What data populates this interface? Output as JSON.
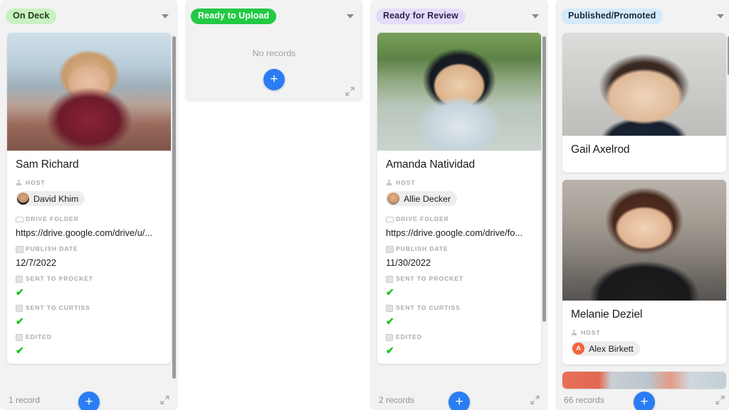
{
  "columns": [
    {
      "id": "on-deck",
      "tag": "On Deck",
      "tag_bg": "#c8f0c0",
      "tag_color": "#1e3a1a",
      "record_count": "1 record",
      "empty_text": null,
      "scrollbar": {
        "top_pct": 1,
        "height_pct": 96
      },
      "cards": [
        {
          "title": "Sam Richard",
          "photo": "ph-sam",
          "fields": [
            {
              "label": "HOST",
              "icon": "person-icon",
              "type": "chip",
              "value": "David Khim",
              "avatar_class": "ph-david",
              "avatar_letter": ""
            },
            {
              "label": "DRIVE FOLDER",
              "icon": "link-icon",
              "type": "text",
              "value": "https://drive.google.com/drive/u/..."
            },
            {
              "label": "PUBLISH DATE",
              "icon": "calendar-icon",
              "type": "text",
              "value": "12/7/2022"
            },
            {
              "label": "SENT TO PROCKET",
              "icon": "checkbox-icon",
              "type": "check",
              "value": "✔"
            },
            {
              "label": "SENT TO CURTISS",
              "icon": "checkbox-icon",
              "type": "check",
              "value": "✔"
            },
            {
              "label": "EDITED",
              "icon": "checkbox-icon",
              "type": "check",
              "value": "✔"
            }
          ]
        }
      ]
    },
    {
      "id": "ready-to-upload",
      "tag": "Ready to Upload",
      "tag_bg": "#22c944",
      "tag_color": "#ffffff",
      "record_count": null,
      "empty_text": "No records",
      "scrollbar": null,
      "cards": []
    },
    {
      "id": "ready-for-review",
      "tag": "Ready for Review",
      "tag_bg": "#e5dcfb",
      "tag_color": "#2c2550",
      "record_count": "2 records",
      "scrollbar": {
        "top_pct": 1,
        "height_pct": 80
      },
      "empty_text": null,
      "cards": [
        {
          "title": "Amanda Natividad",
          "photo": "ph-amanda",
          "fields": [
            {
              "label": "HOST",
              "icon": "person-icon",
              "type": "chip",
              "value": "Allie Decker",
              "avatar_class": "ph-allie",
              "avatar_letter": ""
            },
            {
              "label": "DRIVE FOLDER",
              "icon": "link-icon",
              "type": "text",
              "value": "https://drive.google.com/drive/fo..."
            },
            {
              "label": "PUBLISH DATE",
              "icon": "calendar-icon",
              "type": "text",
              "value": "11/30/2022"
            },
            {
              "label": "SENT TO PROCKET",
              "icon": "checkbox-icon",
              "type": "check",
              "value": "✔"
            },
            {
              "label": "SENT TO CURTISS",
              "icon": "checkbox-icon",
              "type": "check",
              "value": "✔"
            },
            {
              "label": "EDITED",
              "icon": "checkbox-icon",
              "type": "check",
              "value": "✔"
            }
          ]
        }
      ]
    },
    {
      "id": "published-promoted",
      "tag": "Published/Promoted",
      "tag_bg": "#d4eafb",
      "tag_color": "#1c2c3c",
      "record_count": "66 records",
      "scrollbar": {
        "top_pct": 1,
        "height_pct": 11
      },
      "empty_text": null,
      "cards": [
        {
          "title": "Gail Axelrod",
          "photo": "ph-gail",
          "fields": []
        },
        {
          "title": "Melanie Deziel",
          "photo": "ph-melanie",
          "fields": [
            {
              "label": "HOST",
              "icon": "person-icon",
              "type": "chip",
              "value": "Alex Birkett",
              "avatar_class": "avatar-orange",
              "avatar_letter": "A"
            }
          ]
        },
        {
          "title": "",
          "photo": "ph-strip",
          "fields": []
        }
      ]
    }
  ],
  "footer": {
    "add_label": "+",
    "expand_icon": "expand-icon"
  },
  "icons": {
    "dropdown": "chevron-down-icon",
    "add": "plus-icon"
  }
}
